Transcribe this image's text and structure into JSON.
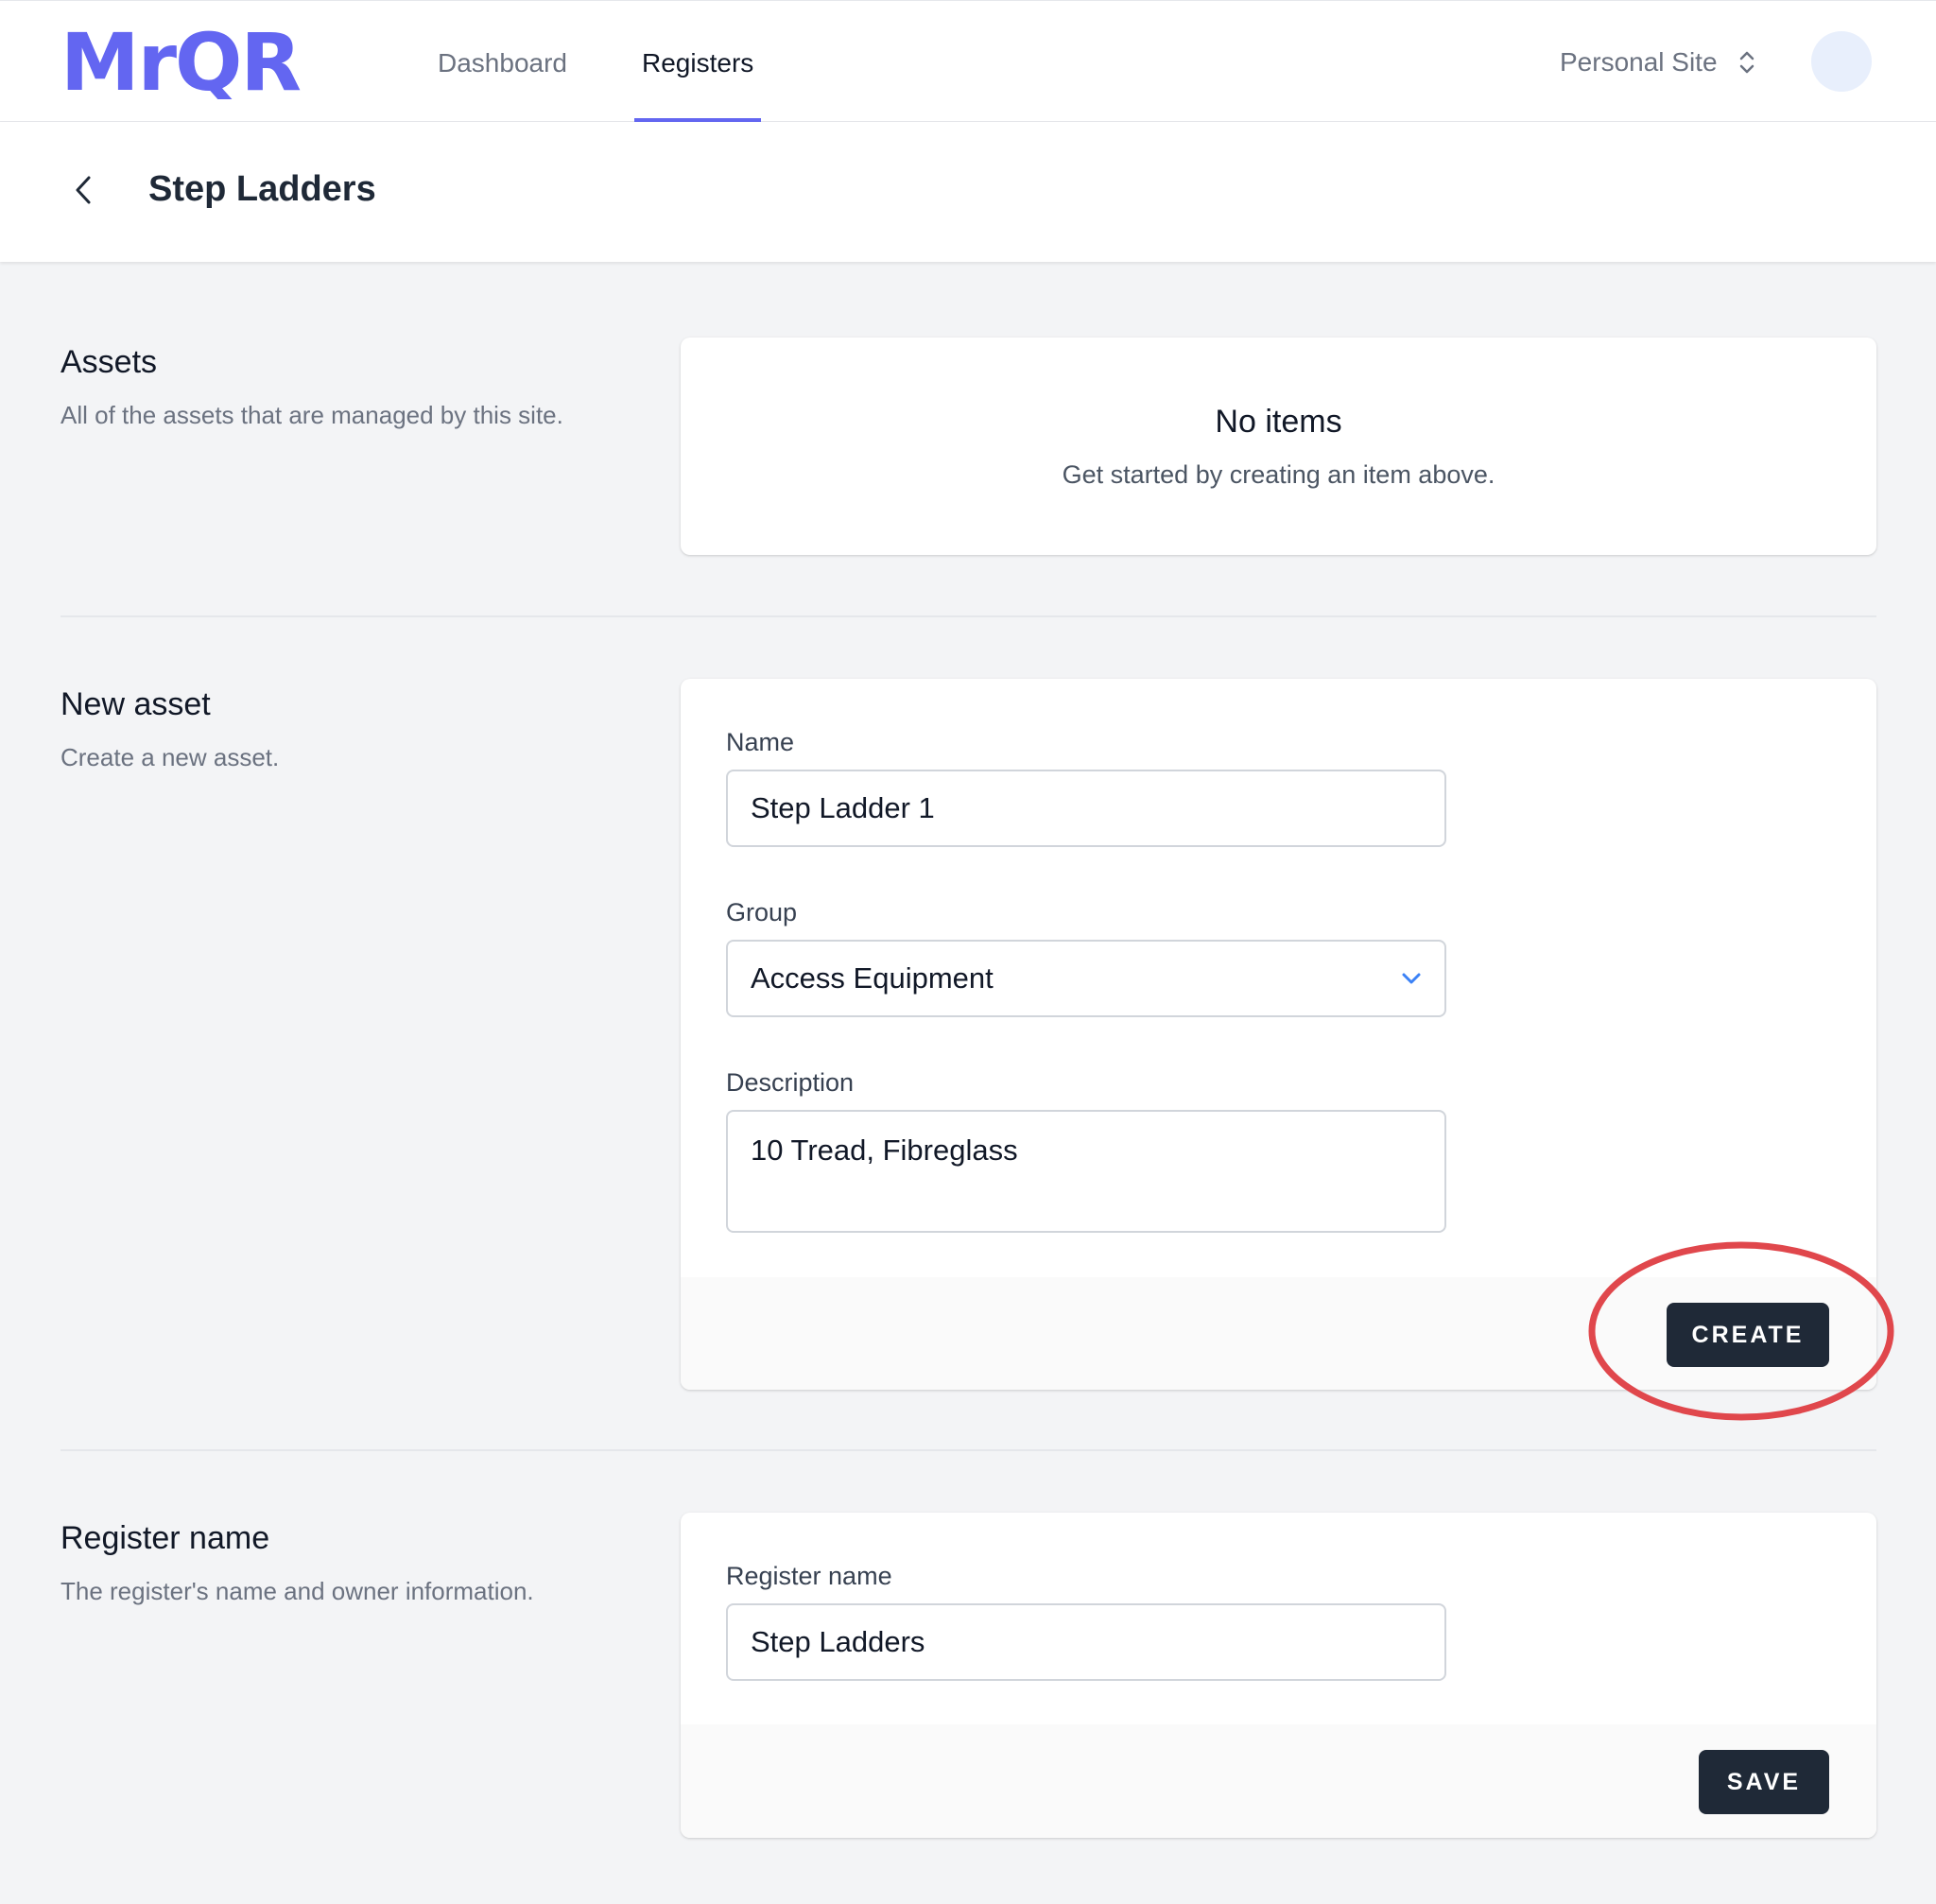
{
  "app": {
    "logo_text": "MrQR",
    "brand_color": "#6366f1"
  },
  "nav": {
    "items": [
      {
        "label": "Dashboard",
        "active": false
      },
      {
        "label": "Registers",
        "active": true
      }
    ],
    "site_switcher": {
      "label": "Personal Site",
      "icon": "chevron-up-down-icon"
    },
    "avatar": {
      "icon": "avatar"
    }
  },
  "page": {
    "title": "Step Ladders",
    "back_icon": "chevron-left-icon"
  },
  "assets_section": {
    "title": "Assets",
    "description": "All of the assets that are managed by this site.",
    "empty_title": "No items",
    "empty_description": "Get started by creating an item above."
  },
  "new_asset_section": {
    "title": "New asset",
    "description": "Create a new asset.",
    "name_label": "Name",
    "name_value": "Step Ladder 1",
    "group_label": "Group",
    "group_value": "Access Equipment",
    "description_label": "Description",
    "description_value": "10 Tread, Fibreglass",
    "create_label": "CREATE",
    "annotation_color": "#e0474c"
  },
  "register_section": {
    "title": "Register name",
    "description": "The register's name and owner information.",
    "field_label": "Register name",
    "field_value": "Step Ladders",
    "save_label": "SAVE"
  }
}
